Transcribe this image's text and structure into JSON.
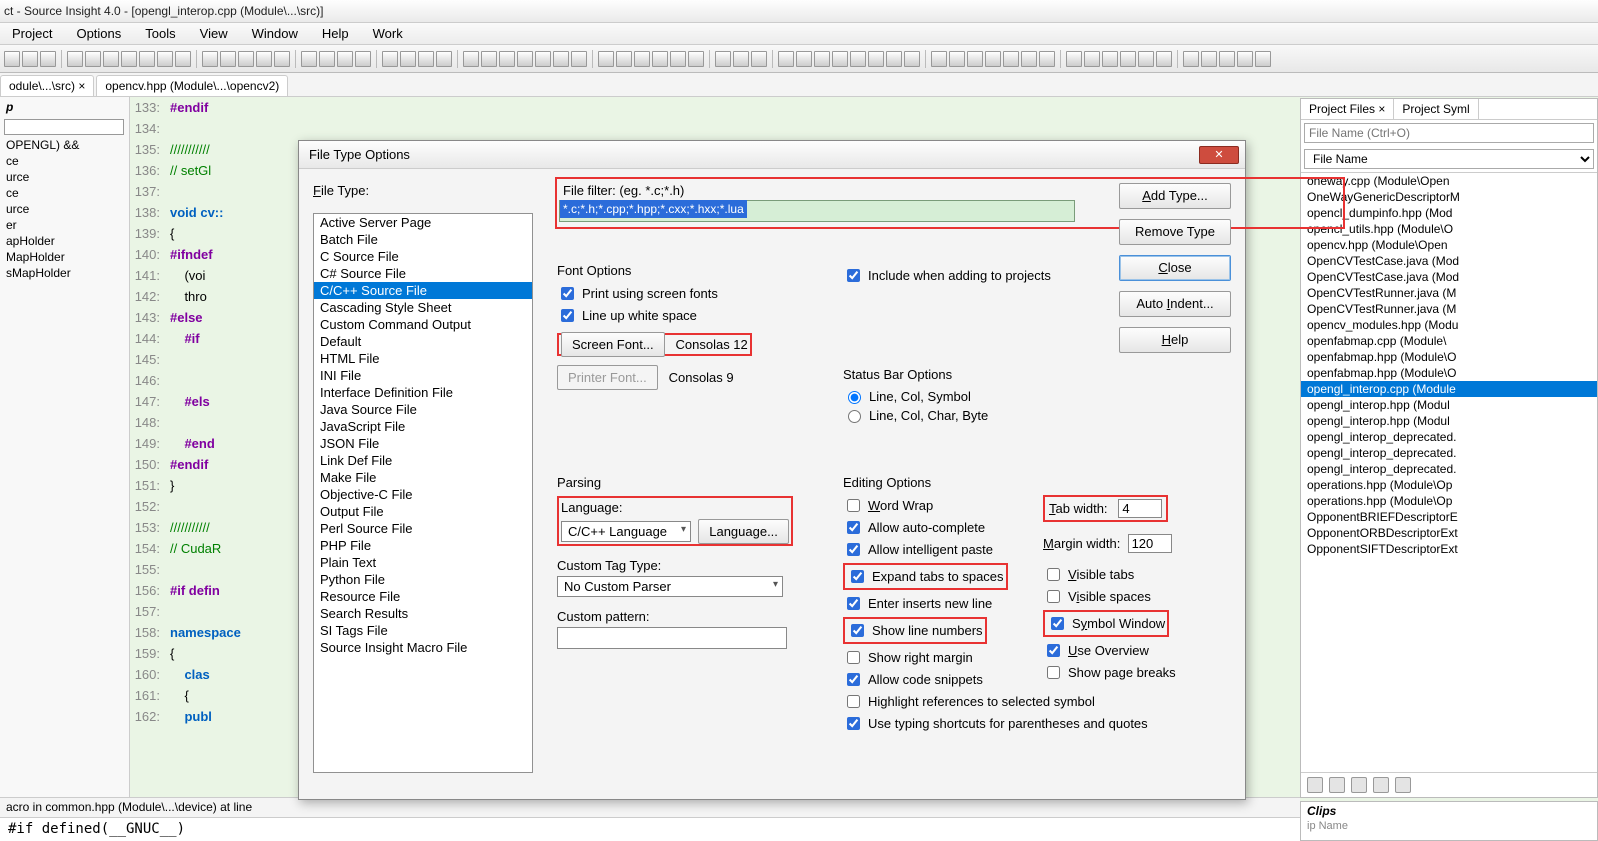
{
  "titlebar": "ct - Source Insight 4.0 - [opengl_interop.cpp (Module\\...\\src)]",
  "menu": [
    "Project",
    "Options",
    "Tools",
    "View",
    "Window",
    "Help",
    "Work"
  ],
  "tabs": [
    {
      "label": "odule\\...\\src) ×"
    },
    {
      "label": "opencv.hpp (Module\\...\\opencv2)"
    }
  ],
  "leftpanel": {
    "title": "p",
    "items": [
      "OPENGL) &&",
      "ce",
      "urce",
      "ce",
      "urce",
      "er",
      "apHolder",
      "MapHolder",
      "sMapHolder"
    ]
  },
  "editor_first_line": 133,
  "editor_lines": [
    "#endif",
    "",
    "///////////",
    "// setGl",
    "",
    "void cv::",
    "{",
    "#ifndef",
    "    (voi",
    "    thro",
    "#else",
    "    #if",
    "",
    "",
    "    #els",
    "",
    "    #end",
    "#endif",
    "}",
    "",
    "///////////",
    "// CudaR",
    "",
    "#if defin",
    "",
    "namespace",
    "{",
    "    clas",
    "    {",
    "    publ"
  ],
  "rightpanel": {
    "tabs": [
      "Project Files ×",
      "Project Syml"
    ],
    "placeholder": "File Name (Ctrl+O)",
    "col": "File Name",
    "selected_index": 13,
    "files": [
      "oneway.cpp (Module\\Open",
      "OneWayGenericDescriptorM",
      "opencl_dumpinfo.hpp (Mod",
      "opencl_utils.hpp (Module\\O",
      "opencv.hpp (Module\\Open",
      "OpenCVTestCase.java (Mod",
      "OpenCVTestCase.java (Mod",
      "OpenCVTestRunner.java (M",
      "OpenCVTestRunner.java (M",
      "opencv_modules.hpp (Modu",
      "openfabmap.cpp (Module\\",
      "openfabmap.hpp (Module\\O",
      "openfabmap.hpp (Module\\O",
      "opengl_interop.cpp (Module",
      "opengl_interop.hpp (Modul",
      "opengl_interop.hpp (Modul",
      "opengl_interop_deprecated.",
      "opengl_interop_deprecated.",
      "opengl_interop_deprecated.",
      "operations.hpp (Module\\Op",
      "operations.hpp (Module\\Op",
      "OpponentBRIEFDescriptorE",
      "OpponentORBDescriptorExt",
      "OpponentSIFTDescriptorExt"
    ]
  },
  "clips": {
    "title": "Clips",
    "sub": "ip Name"
  },
  "status": "acro in common.hpp (Module\\...\\device) at line",
  "bottomline": "#if defined(__GNUC__)",
  "dialog": {
    "title": "File Type Options",
    "filetype_label": "File Type:",
    "selected_type_index": 5,
    "filetypes": [
      "Active Server Page",
      "Batch File",
      "C Source File",
      "C# Source File",
      "C/C++ Source File",
      "Cascading Style Sheet",
      "Custom Command Output",
      "Default",
      "HTML File",
      "INI File",
      "Interface Definition File",
      "Java Source File",
      "JavaScript File",
      "JSON File",
      "Link Def File",
      "Make File",
      "Objective-C File",
      "Output File",
      "Perl Source File",
      "PHP File",
      "Plain Text",
      "Python File",
      "Resource File",
      "Search Results",
      "SI Tags File",
      "Source Insight Macro File"
    ],
    "filter_label": "File filter: (eg. *.c;*.h)",
    "filter_value": "*.c;*.h;*.cpp;*.hpp;*.cxx;*.hxx;*.lua",
    "btn_addtype": "Add Type...",
    "btn_removetype": "Remove Type",
    "btn_close": "Close",
    "btn_autoindent": "Auto Indent...",
    "btn_help": "Help",
    "font_options": "Font Options",
    "chk_printscreen": "Print using screen fonts",
    "chk_linewhite": "Line up white space",
    "btn_screenfont": "Screen Font...",
    "screenfont_val": "Consolas 12",
    "btn_printerfont": "Printer Font...",
    "printerfont_val": "Consolas 9",
    "chk_include": "Include when adding to projects",
    "statusbar": "Status Bar Options",
    "rad_lcs": "Line, Col, Symbol",
    "rad_lccb": "Line, Col, Char, Byte",
    "parsing": "Parsing",
    "language_lbl": "Language:",
    "language_val": "C/C++ Language",
    "btn_language": "Language...",
    "customtag_lbl": "Custom Tag Type:",
    "customtag_val": "No Custom Parser",
    "custompattern_lbl": "Custom pattern:",
    "editing": "Editing Options",
    "chk_wordwrap": "Word Wrap",
    "chk_autocomplete": "Allow auto-complete",
    "chk_intellipaste": "Allow intelligent paste",
    "chk_expandtabs": "Expand tabs to spaces",
    "chk_enterinserts": "Enter inserts new line",
    "chk_showline": "Show line numbers",
    "chk_showmargin": "Show right margin",
    "chk_codesnip": "Allow code snippets",
    "chk_highlight": "Highlight references to selected symbol",
    "chk_typingshort": "Use typing shortcuts for parentheses and quotes",
    "tabwidth_lbl": "Tab width:",
    "tabwidth_val": "4",
    "marginwidth_lbl": "Margin width:",
    "marginwidth_val": "120",
    "chk_vistabs": "Visible tabs",
    "chk_visspaces": "Visible spaces",
    "chk_symwin": "Symbol Window",
    "chk_useoverview": "Use Overview",
    "chk_pagebreaks": "Show page breaks"
  }
}
